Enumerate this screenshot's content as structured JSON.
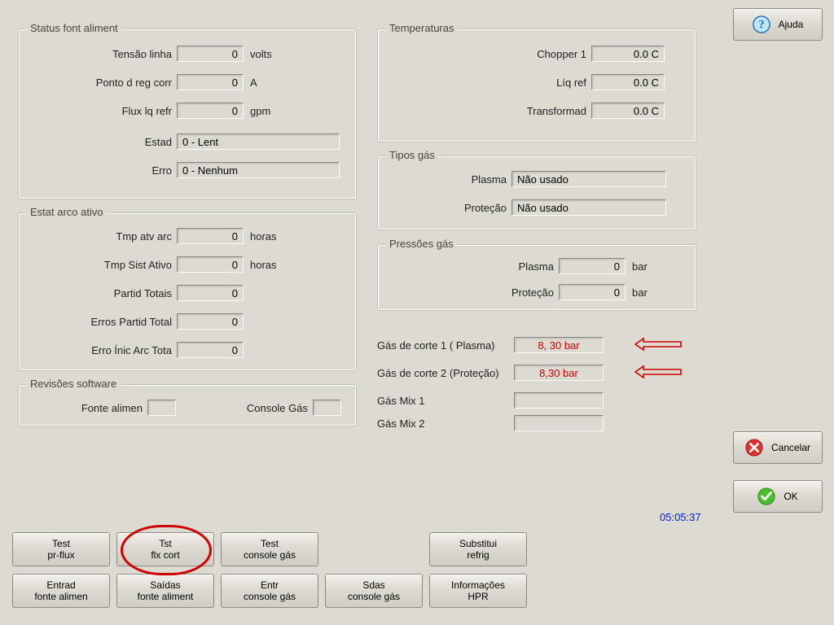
{
  "help_button": {
    "label": "Ajuda"
  },
  "cancel_button": {
    "label": "Cancelar"
  },
  "ok_button": {
    "label": "OK"
  },
  "clock": "05:05:37",
  "groups": {
    "status_font": {
      "title": "Status font aliment",
      "rows": {
        "line_voltage": {
          "label": "Tensão linha",
          "value": "0",
          "unit": "volts"
        },
        "current_setpoint": {
          "label": "Ponto d reg corr",
          "value": "0",
          "unit": "A"
        },
        "coolant_flow": {
          "label": "Flux lq refr",
          "value": "0",
          "unit": "gpm"
        },
        "state": {
          "label": "Estad",
          "value": "0 - Lent"
        },
        "error": {
          "label": "Erro",
          "value": "0 - Nenhum"
        }
      }
    },
    "arc_stats": {
      "title": "Estat arco ativo",
      "rows": {
        "arc_on_time": {
          "label": "Tmp atv arc",
          "value": "0",
          "unit": "horas"
        },
        "system_on_time": {
          "label": "Tmp Sist Ativo",
          "value": "0",
          "unit": "horas"
        },
        "total_starts": {
          "label": "Partid Totais",
          "value": "0"
        },
        "start_errors": {
          "label": "Erros Partid Total",
          "value": "0"
        },
        "arc_init_errors": {
          "label": "Erro Ínic Arc Tota",
          "value": "0"
        }
      }
    },
    "software_rev": {
      "title": "Revisões software",
      "rows": {
        "ps": {
          "label": "Fonte alimen",
          "value": ""
        },
        "gas": {
          "label": "Console Gás",
          "value": ""
        }
      }
    },
    "temperatures": {
      "title": "Temperaturas",
      "rows": {
        "chopper1": {
          "label": "Chopper 1",
          "value": "0.0 C"
        },
        "coolant": {
          "label": "Líq ref",
          "value": "0.0 C"
        },
        "transformer": {
          "label": "Transformad",
          "value": "0.0 C"
        }
      }
    },
    "gas_types": {
      "title": "Tipos gás",
      "rows": {
        "plasma": {
          "label": "Plasma",
          "value": "Não usado"
        },
        "shield": {
          "label": "Proteção",
          "value": "Não usado"
        }
      }
    },
    "gas_pressures": {
      "title": "Pressões gás",
      "rows": {
        "plasma": {
          "label": "Plasma",
          "value": "0",
          "unit": "bar"
        },
        "shield": {
          "label": "Proteção",
          "value": "0",
          "unit": "bar"
        }
      }
    }
  },
  "cut_gases": {
    "g1": {
      "label": "Gás de corte 1 ( Plasma)",
      "value": "8, 30 bar"
    },
    "g2": {
      "label": "Gás de corte 2 (Proteção)",
      "value": "8,30 bar"
    },
    "mix1": {
      "label": "Gás Mix 1",
      "value": ""
    },
    "mix2": {
      "label": "Gás Mix 2",
      "value": ""
    }
  },
  "bottom_buttons": {
    "test_preflow": {
      "line1": "Test",
      "line2": "pr-flux"
    },
    "test_cutflow": {
      "line1": "Tst",
      "line2": "flx cort"
    },
    "test_gasconsole": {
      "line1": "Test",
      "line2": "console gás"
    },
    "replace_coolant": {
      "line1": "Substitui",
      "line2": "refrig"
    },
    "inputs_ps": {
      "line1": "Entrad",
      "line2": "fonte alimen"
    },
    "outputs_ps": {
      "line1": "Saídas",
      "line2": "fonte aliment"
    },
    "inputs_gas": {
      "line1": "Entr",
      "line2": "console gás"
    },
    "outputs_gas": {
      "line1": "Sdas",
      "line2": "console gás"
    },
    "hpr_info": {
      "line1": "Informações",
      "line2": "HPR"
    }
  }
}
